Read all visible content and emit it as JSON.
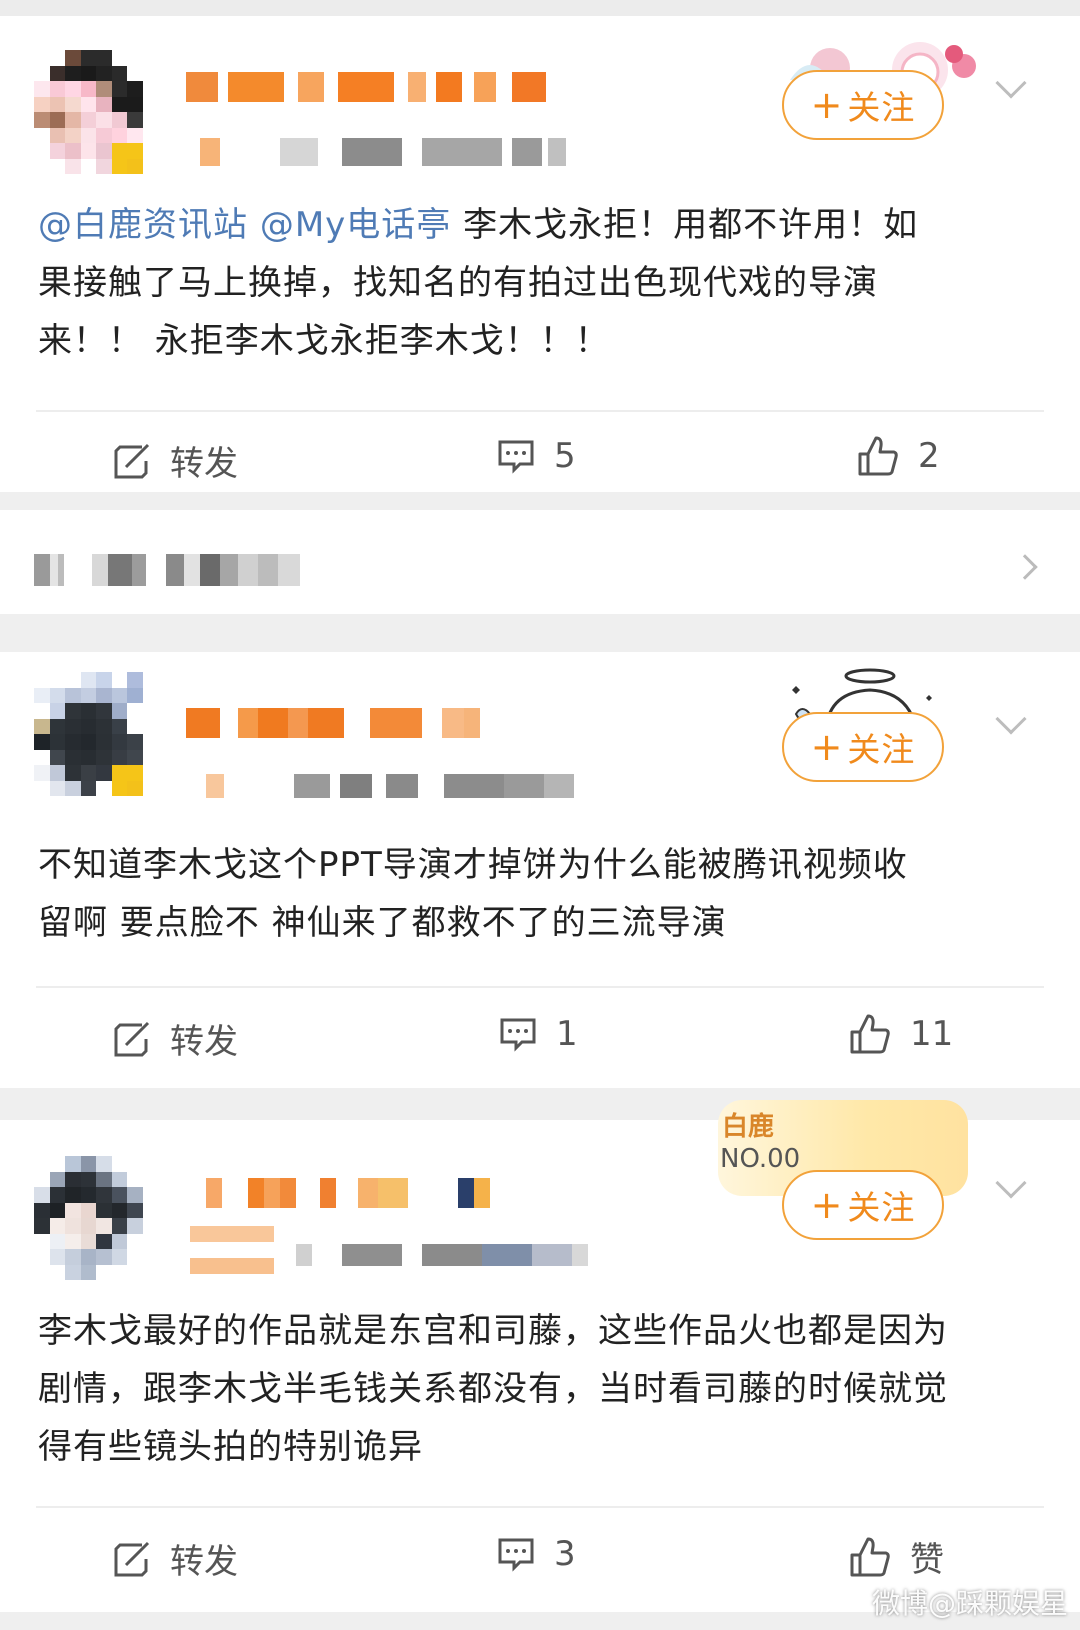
{
  "posts": [
    {
      "follow_label": "关注",
      "follow_plus": "+",
      "text_mention_1": "@白鹿资讯站",
      "text_mention_2": "@My电话亭",
      "text_line_1_rest": " 李木戈永拒！用都不许用！如",
      "text_line_2": "果接触了马上换掉，找知名的有拍过出色现代戏的导演",
      "text_line_3": "来！！ 永拒李木戈永拒李木戈！！！",
      "repost_label": "转发",
      "comment_count": "5",
      "like_label": "2"
    },
    {
      "follow_label": "关注",
      "follow_plus": "+",
      "text_line_1": "不知道李木戈这个PPT导演才掉饼为什么能被腾讯视频收",
      "text_line_2": "留啊 要点脸不 神仙来了都救不了的三流导演",
      "repost_label": "转发",
      "comment_count": "1",
      "like_label": "11"
    },
    {
      "follow_label": "关注",
      "follow_plus": "+",
      "badge_line_1": "白鹿",
      "badge_line_2": "NO.00",
      "text_line_1": "李木戈最好的作品就是东宫和司藤，这些作品火也都是因为",
      "text_line_2": "剧情，跟李木戈半毛钱关系都没有，当时看司藤的时候就觉",
      "text_line_3": "得有些镜头拍的特别诡异",
      "repost_label": "转发",
      "comment_count": "3",
      "like_label": "赞"
    }
  ],
  "watermark": "微博@踩颗娱星",
  "colors": {
    "accent_orange": "#f08a1c",
    "mention_blue": "#4f7bb5",
    "text": "#222222",
    "icon_gray": "#555555"
  },
  "icons": [
    "repost-icon",
    "comment-icon",
    "like-icon",
    "chevron-down-icon",
    "chevron-right-icon"
  ]
}
